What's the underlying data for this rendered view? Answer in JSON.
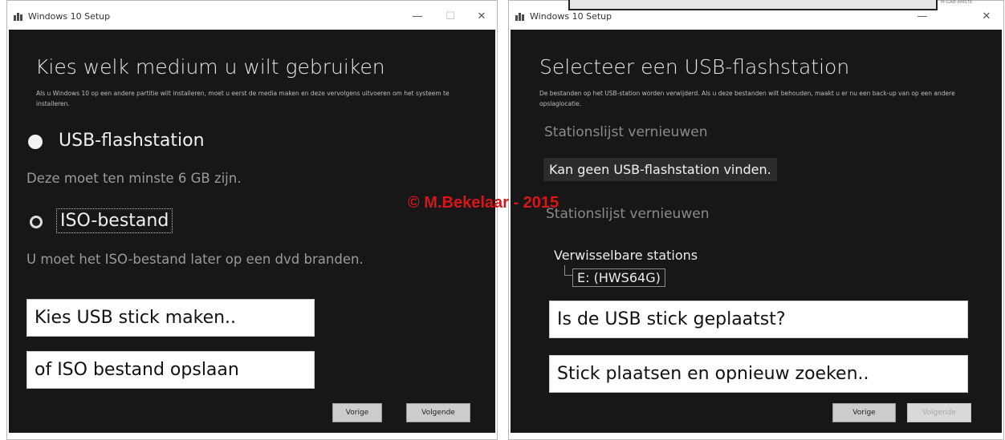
{
  "left_window": {
    "title": "Windows 10 Setup",
    "controls": {
      "minimize": "—",
      "maximize": "☐",
      "close": "✕"
    },
    "heading": "Kies welk medium u wilt gebruiken",
    "description": "Als u Windows 10 op een andere partitie wilt installeren, moet u eerst de media maken en deze vervolgens uitvoeren om het systeem te installeren.",
    "options": [
      {
        "label": "USB-flashstation",
        "selected": true,
        "note": "Deze moet ten minste 6 GB zijn."
      },
      {
        "label": "ISO-bestand",
        "selected": false,
        "note": "U moet het ISO-bestand later op een dvd branden."
      }
    ],
    "callouts": [
      "Kies USB stick maken..",
      "of ISO bestand opslaan"
    ],
    "buttons": {
      "back": "Vorige",
      "next": "Volgende"
    }
  },
  "right_window": {
    "title": "Windows 10 Setup",
    "controls": {
      "minimize": "—",
      "close": "✕"
    },
    "heading": "Selecteer een USB-flashstation",
    "description": "De bestanden op het USB-station worden verwijderd. Als u deze bestanden wilt behouden, maakt u er nu een back-up van op een andere opslaglocatie.",
    "refresh_link_top": "Stationslijst vernieuwen",
    "error_message": "Kan geen USB-flashstation vinden.",
    "refresh_link_bottom": "Stationslijst vernieuwen",
    "removable_header": "Verwisselbare stations",
    "drive": "E: (HWS64G)",
    "callouts": [
      "Is de USB stick geplaatst?",
      "Stick plaatsen en opnieuw zoeken.."
    ],
    "buttons": {
      "back": "Vorige",
      "next": "Volgende",
      "next_disabled": true
    }
  },
  "watermark": "© M.Bekelaar - 2015",
  "corner_text": "M-GAB AMSTE"
}
